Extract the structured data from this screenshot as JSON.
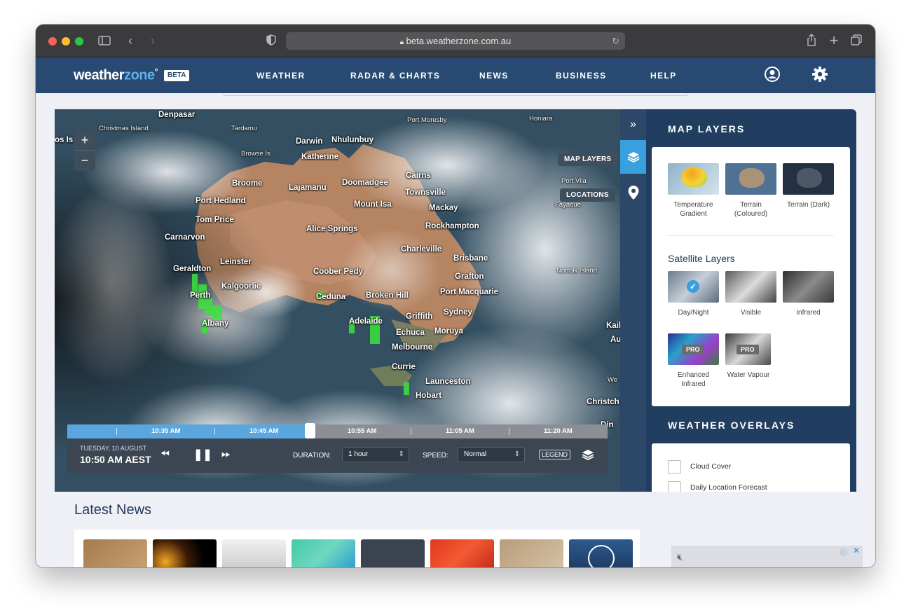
{
  "browser": {
    "url": "beta.weatherzone.com.au",
    "traffic_colors": [
      "#fe5f57",
      "#febc2e",
      "#28c840"
    ]
  },
  "nav": {
    "logo_main": "weather",
    "logo_accent": "zone",
    "logo_sup": "°",
    "beta": "BETA",
    "links": [
      "WEATHER",
      "RADAR & CHARTS",
      "NEWS",
      "BUSINESS",
      "HELP"
    ]
  },
  "map": {
    "map_layers_btn": "MAP LAYERS",
    "locations_btn": "LOCATIONS",
    "zoom_in": "+",
    "zoom_out": "−",
    "places": [
      "Denpasar",
      "Christmas Island",
      "Tardamu",
      "Darwin",
      "Nhulunbuy",
      "Port Moresby",
      "Honiara",
      "Katherine",
      "Browse Is",
      "Broome",
      "Lajamanu",
      "Doomadgee",
      "Cairns",
      "Townsville",
      "Port Vila",
      "Port Hedland",
      "Mount Isa",
      "Mackay",
      "Fayaoue",
      "Tom Price",
      "Alice Springs",
      "Rockhampton",
      "Carnarvon",
      "Charleville",
      "Brisbane",
      "Leinster",
      "Geraldton",
      "Coober Pedy",
      "Norfolk Island",
      "Grafton",
      "Kalgoorlie",
      "Port Macquarie",
      "Broken Hill",
      "Perth",
      "Ceduna",
      "Sydney",
      "Griffith",
      "Adelaide",
      "Echuca",
      "Moruya",
      "Albany",
      "Melbourne",
      "Currie",
      "Launceston",
      "Hobart",
      "Christch",
      "Kail",
      "Au",
      "We",
      "os Is",
      "Din"
    ],
    "times": [
      "10:35 AM",
      "10:45 AM",
      "10:55 AM",
      "11:05 AM",
      "11:20 AM"
    ],
    "date": "TUESDAY, 10 AUGUST",
    "current_time": "10:50 AM AEST",
    "duration_label": "DURATION:",
    "duration_value": "1 hour",
    "speed_label": "SPEED:",
    "speed_value": "Normal",
    "legend": "LEGEND",
    "progress": 0.45
  },
  "sidebar": {
    "title": "MAP LAYERS",
    "base_layers": [
      "Temperature Gradient",
      "Terrain (Coloured)",
      "Terrain (Dark)"
    ],
    "satellite_title": "Satellite Layers",
    "satellite_layers": [
      "Day/Night",
      "Visible",
      "Infrared",
      "Enhanced Infrared",
      "Water Vapour"
    ],
    "pro": "PRO",
    "overlays_title": "WEATHER OVERLAYS",
    "overlays": [
      "Cloud Cover",
      "Daily Location Forecast"
    ]
  },
  "news": {
    "title": "Latest News"
  }
}
